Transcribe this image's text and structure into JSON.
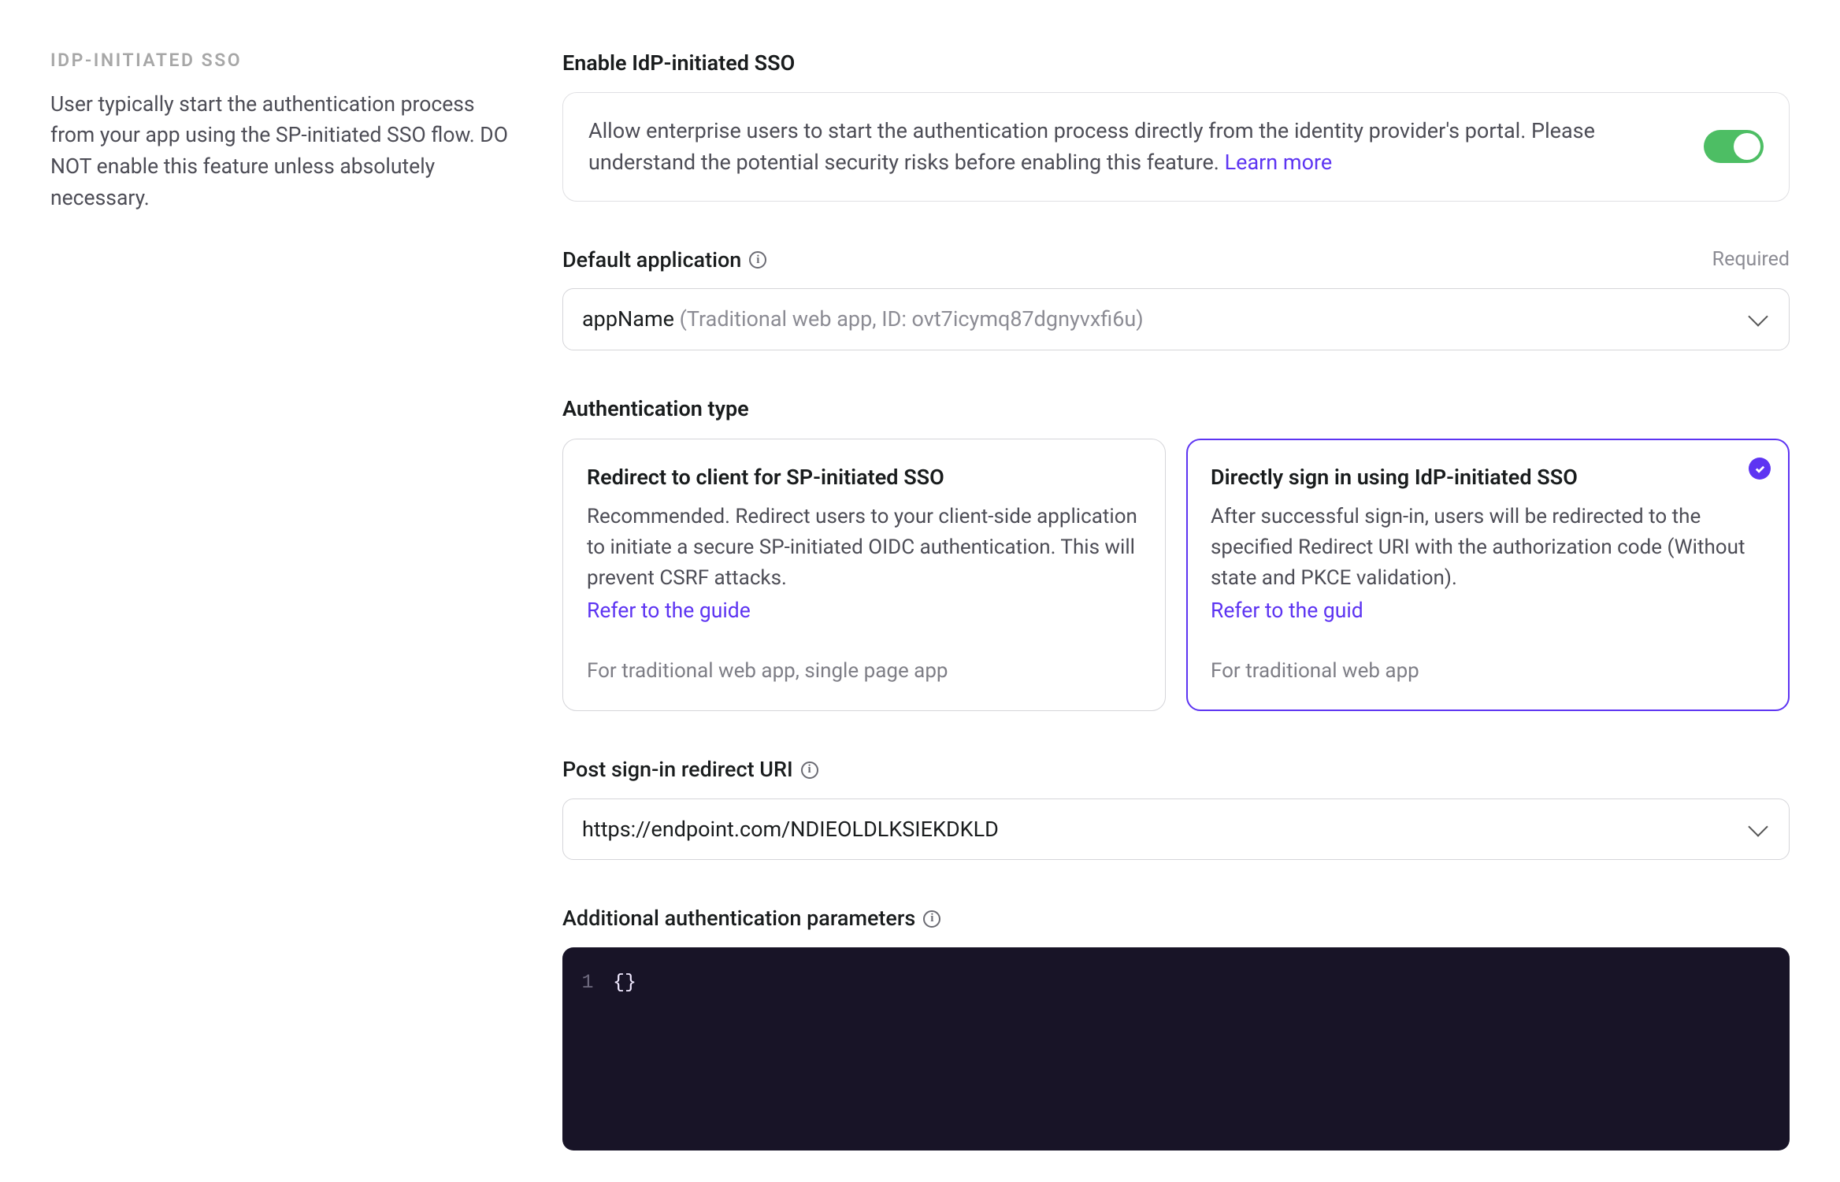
{
  "sidebar": {
    "title": "IDP-INITIATED SSO",
    "description": "User typically start the authentication process from your app using the SP-initiated SSO flow. DO NOT enable this feature unless absolutely necessary."
  },
  "enable_section": {
    "title": "Enable IdP-initiated SSO",
    "body": "Allow enterprise users to start the authentication process directly from the identity provider's portal. Please understand the potential security risks before enabling this feature. ",
    "link_label": "Learn more",
    "toggle_on": true
  },
  "default_app": {
    "label": "Default application",
    "required_label": "Required",
    "value_main": "appName",
    "value_sub": " (Traditional web app, ID: ovt7icymq87dgnyvxfi6u)"
  },
  "auth_type": {
    "label": "Authentication type",
    "options": [
      {
        "title": "Redirect to client for SP-initiated SSO",
        "desc": "Recommended. Redirect users to your client-side application to initiate a secure SP-initiated OIDC authentication. This will prevent CSRF attacks.",
        "link_label": "Refer to the guide",
        "footer": "For traditional web app, single page app",
        "selected": false
      },
      {
        "title": "Directly sign in using IdP-initiated SSO",
        "desc": "After successful sign-in, users will be redirected to the specified Redirect URI with the authorization code (Without state and PKCE validation).",
        "link_label": "Refer to the guid",
        "footer": "For traditional web app",
        "selected": true
      }
    ]
  },
  "redirect_uri": {
    "label": "Post sign-in redirect URI",
    "value": "https://endpoint.com/NDIEOLDLKSIEKDKLD"
  },
  "additional_params": {
    "label": "Additional authentication parameters",
    "code_line_number": "1",
    "code_content": "{}"
  },
  "colors": {
    "accent": "#5D34F2",
    "toggle_on": "#4DBE64",
    "code_bg": "#181427"
  }
}
